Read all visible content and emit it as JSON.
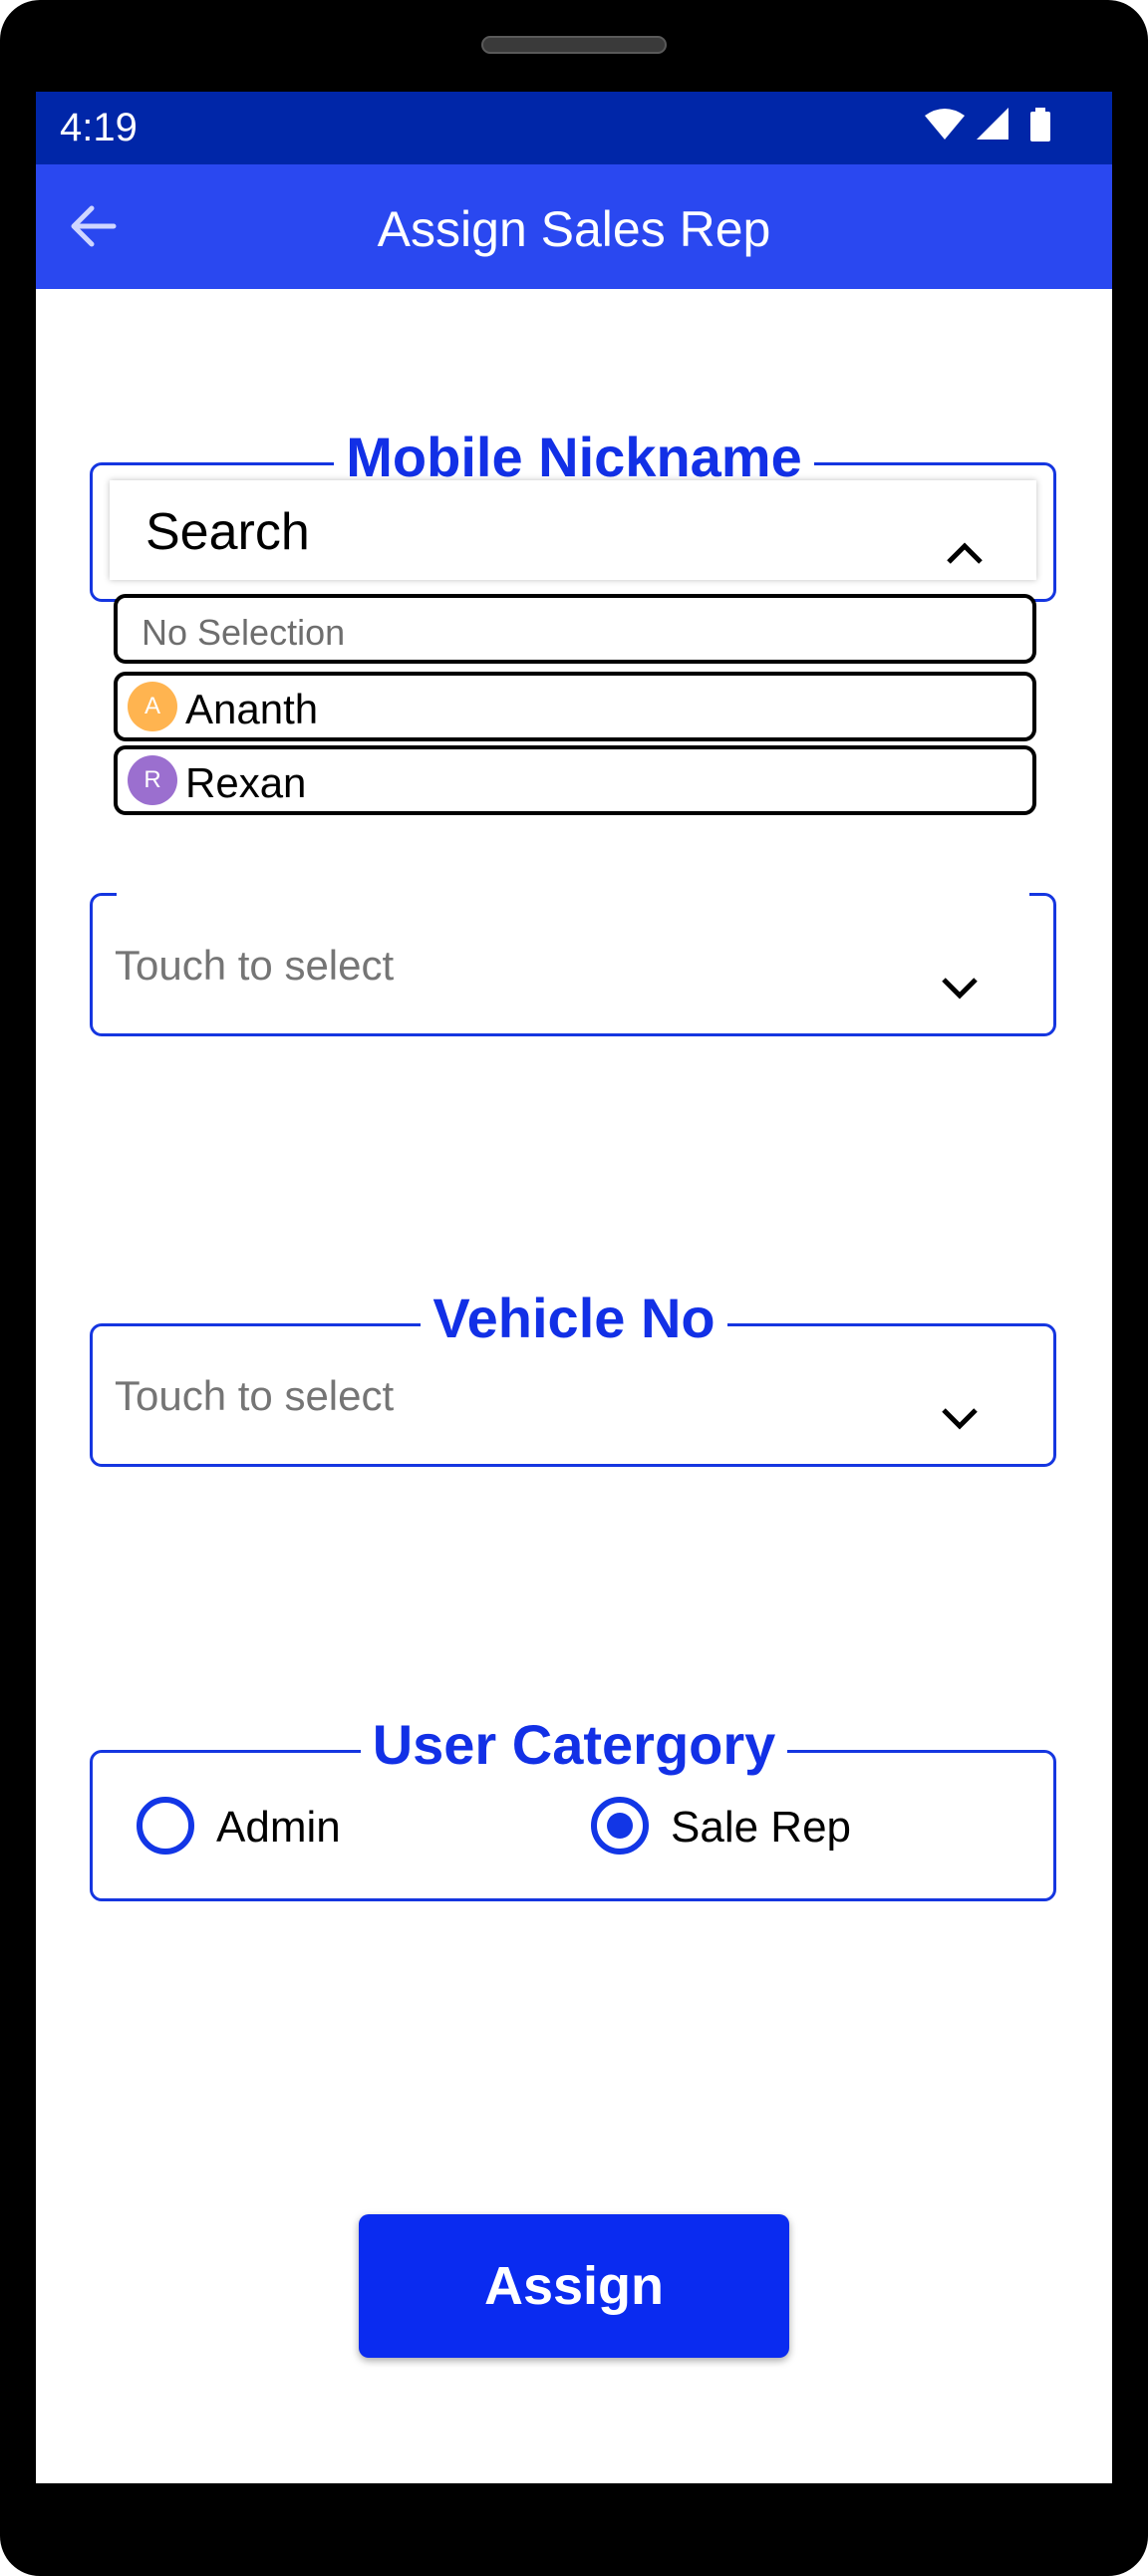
{
  "status_bar": {
    "time": "4:19"
  },
  "app_bar": {
    "title": "Assign Sales Rep",
    "back_icon": "arrow-left-icon"
  },
  "mobile_nickname": {
    "legend": "Mobile Nickname",
    "search_text": "Search",
    "dropdown_open": true,
    "options": [
      {
        "label": "No Selection"
      },
      {
        "label": "Ananth",
        "avatar_letter": "A",
        "avatar_color": "#ffb450"
      },
      {
        "label": "Rexan",
        "avatar_letter": "R",
        "avatar_color": "#9b6fcf"
      }
    ]
  },
  "second_select": {
    "placeholder": "Touch to select"
  },
  "vehicle_no": {
    "legend": "Vehicle No",
    "placeholder": "Touch to select"
  },
  "user_category": {
    "legend": "User Catergory",
    "options": [
      {
        "label": "Admin",
        "selected": false
      },
      {
        "label": "Sale Rep",
        "selected": true
      }
    ]
  },
  "assign_button": {
    "label": "Assign"
  },
  "colors": {
    "accent": "#1230e6",
    "app_bar": "#2a48f0",
    "status_bar": "#0026a8",
    "button": "#0a2bf0"
  }
}
